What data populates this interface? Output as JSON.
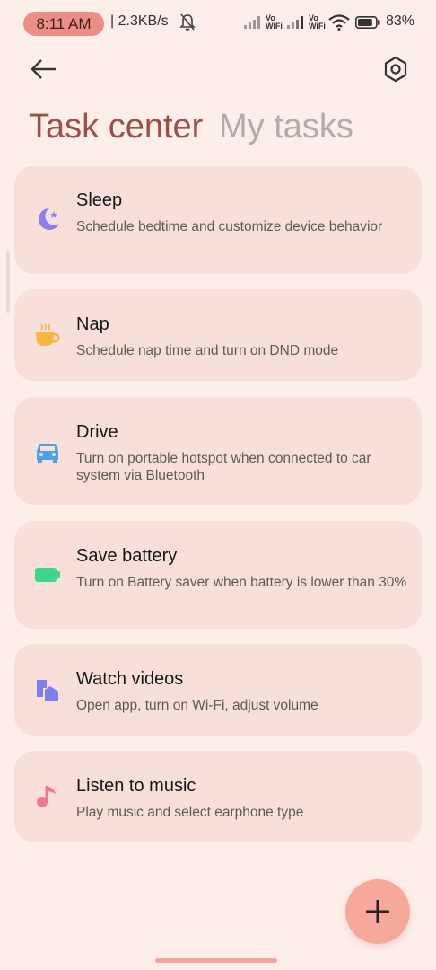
{
  "status_bar": {
    "time": "8:11 AM",
    "net_speed": "| 2.3KB/s",
    "vowifi_1": "Vo\nWiFi",
    "vowifi_2": "Vo\nWiFi",
    "battery_percent": "83%",
    "battery_level": 0.83
  },
  "header": {
    "tab_active": "Task center",
    "tab_inactive": "My tasks"
  },
  "tasks": [
    {
      "icon": "moon-icon",
      "title": "Sleep",
      "description": "Schedule bedtime and customize device behavior"
    },
    {
      "icon": "coffee-cup-icon",
      "title": "Nap",
      "description": "Schedule nap time and turn on DND mode"
    },
    {
      "icon": "car-icon",
      "title": "Drive",
      "description": "Turn on portable hotspot when connected to car system via Bluetooth"
    },
    {
      "icon": "battery-icon",
      "title": "Save battery",
      "description": "Turn on Battery saver when battery is lower than 30%"
    },
    {
      "icon": "video-icon",
      "title": "Watch videos",
      "description": "Open app, turn on Wi-Fi, adjust volume"
    },
    {
      "icon": "music-note-icon",
      "title": "Listen to music",
      "description": "Play music and select earphone type"
    }
  ],
  "colors": {
    "background": "#fdeee9",
    "card": "#f8dfd9",
    "accent_tab": "#9a4f48",
    "fab": "#f6a89a",
    "moon": "#8d7cf0",
    "coffee": "#f6b73c",
    "car": "#4aa3e8",
    "battery": "#3ed68c",
    "video": "#7f7ef0",
    "music": "#f07a96"
  }
}
